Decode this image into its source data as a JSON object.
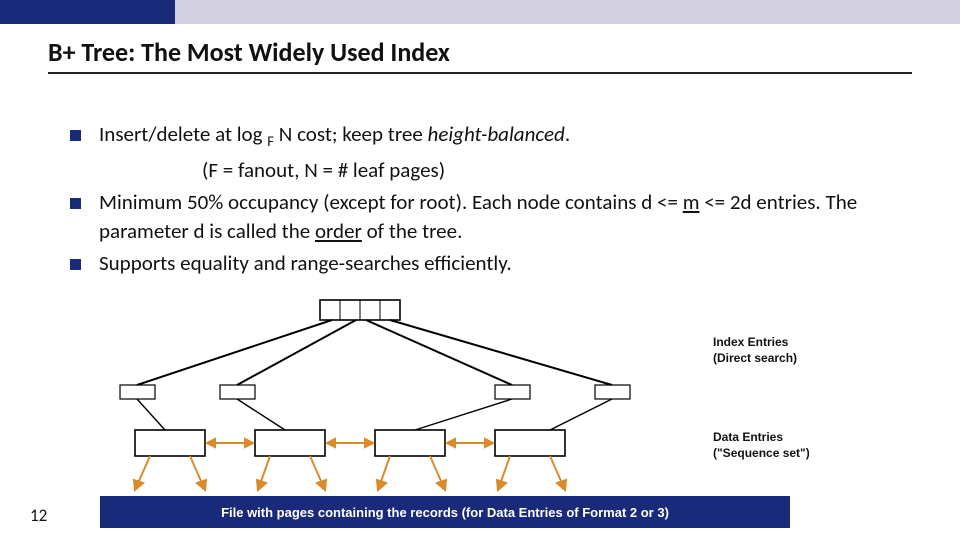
{
  "title": "B+ Tree:  The Most Widely Used Index",
  "bullets": {
    "b1_pre": "Insert/delete at log ",
    "b1_sub": "F",
    "b1_mid": " N cost; keep tree ",
    "b1_ital": "height-balanced",
    "b1_post": ".",
    "indent": "(F = fanout, N = # leaf pages)",
    "b2_pre": "Minimum 50% occupancy (except for root).  Each node contains d <=  ",
    "b2_u": "m",
    "b2_mid": "  <= 2d entries.  The parameter d is called the ",
    "b2_u2": "order",
    "b2_post": " of the tree.",
    "b3": "Supports equality and range-searches efficiently."
  },
  "labels": {
    "index_entries": "Index Entries",
    "direct_search": "(Direct search)",
    "data_entries": "Data Entries",
    "sequence_set": "(\"Sequence set\")"
  },
  "footer": "File with pages containing the records (for Data Entries of Format 2 or 3)",
  "page_number": "12",
  "colors": {
    "brand_blue": "#1a2a7a",
    "arrow_orange": "#d98a2b"
  }
}
